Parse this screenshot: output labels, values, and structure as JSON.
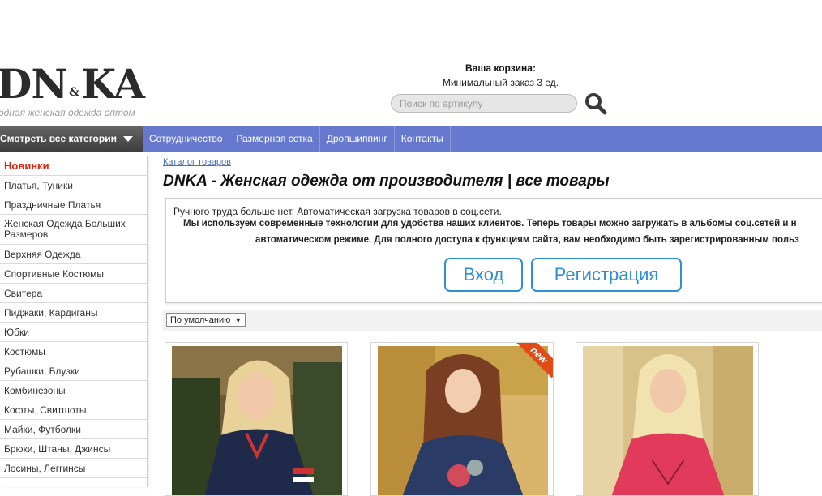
{
  "header": {
    "logo_text": "DN",
    "logo_amp": "&",
    "logo_text2": "KA",
    "logo_tagline": "одная женская одежда оптом",
    "cart_title": "Ваша корзина:",
    "cart_min_order": "Минимальный заказ 3 ед.",
    "search_placeholder": "Поиск по артикулу"
  },
  "nav": {
    "categories_button": "Смотреть все категории",
    "links": [
      "Сотрудничество",
      "Размерная сетка",
      "Дропшиппинг",
      "Контакты"
    ]
  },
  "sidebar": {
    "items": [
      "Новинки",
      "Платья, Туники",
      "Праздничные Платья",
      "Женская Одежда Больших Размеров",
      "Верхняя Одежда",
      "Спортивные Костюмы",
      "Свитера",
      "Пиджаки, Кардиганы",
      "Юбки",
      "Костюмы",
      "Рубашки, Блузки",
      "Комбинезоны",
      "Кофты, Свитшоты",
      "Майки, Футболки",
      "Брюки, Штаны, Джинсы",
      "Лосины, Леггинсы"
    ]
  },
  "main": {
    "breadcrumb": "Каталог товаров",
    "title": "DNKA - Женская одежда от производителя | все товары",
    "notice_line1": "Ручного труда больше нет. Автоматическая загрузка товаров в соц.сети.",
    "notice_line2": "Мы используем современные технологии для удобства наших клиентов. Теперь товары можно загружать в альбомы соц.сетей и н",
    "notice_line3": "автоматическом режиме. Для полного доступа к функциям сайта, вам необходимо быть зарегистрированным польз",
    "login_button": "Вход",
    "register_button": "Регистрация",
    "sort_value": "По умолчанию",
    "new_badge": "new"
  },
  "colors": {
    "nav_bar": "#6679ce",
    "accent_blue": "#2f8ed8",
    "new_red": "#d21",
    "ribbon": "#e24a17"
  }
}
